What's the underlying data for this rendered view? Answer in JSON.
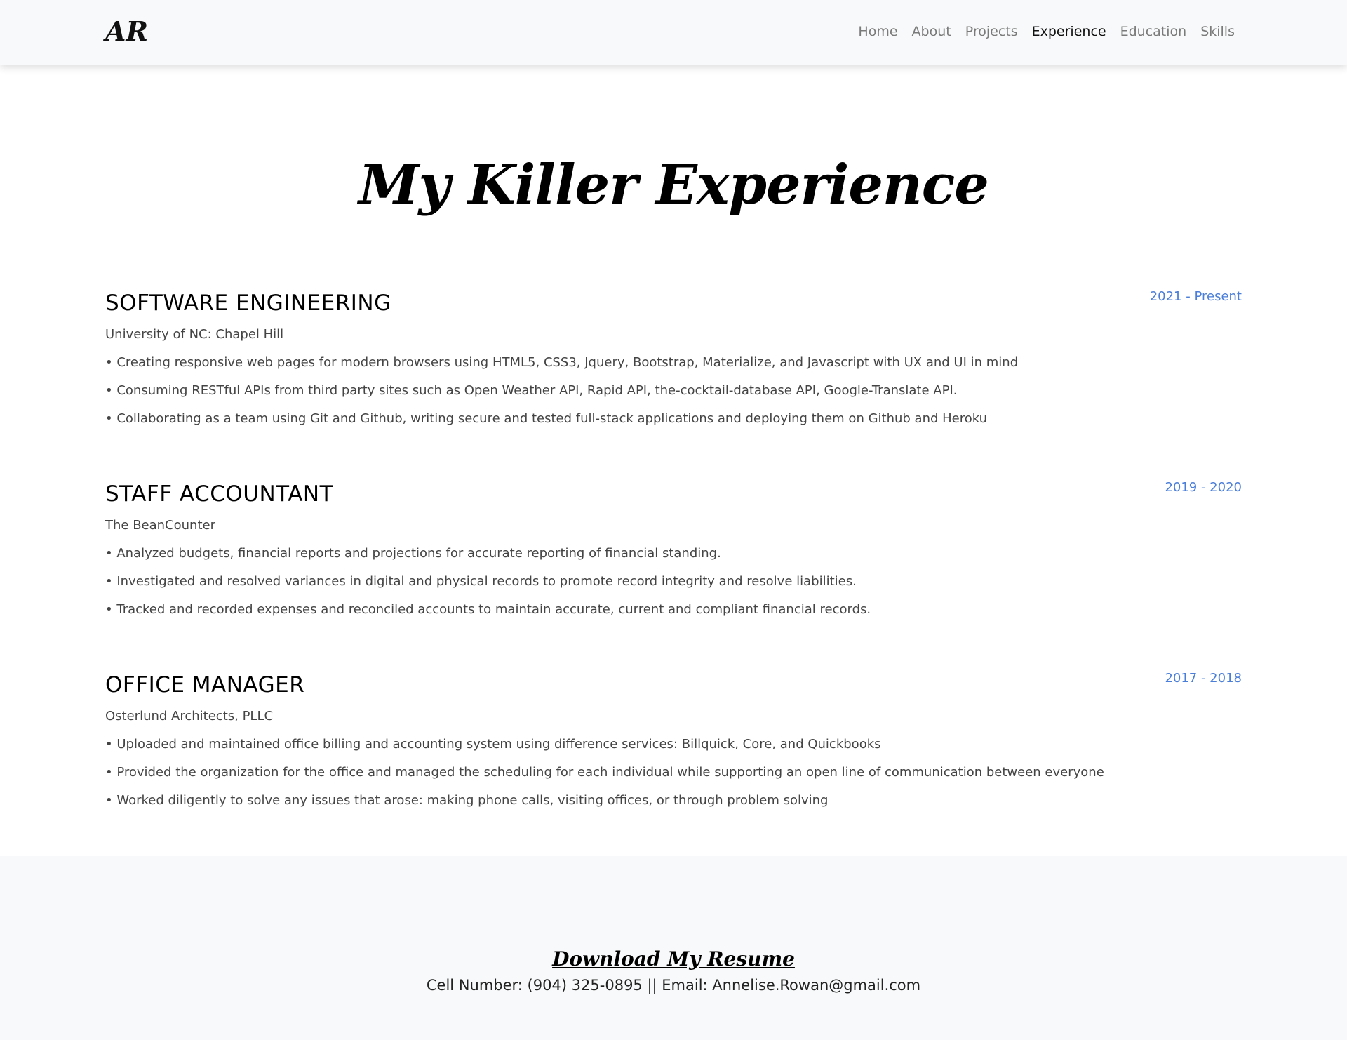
{
  "nav": {
    "brand": "AR",
    "links": [
      "Home",
      "About",
      "Projects",
      "Experience",
      "Education",
      "Skills"
    ],
    "active": "Experience"
  },
  "page_title": "My Killer Experience",
  "experiences": [
    {
      "title": "SOFTWARE ENGINEERING",
      "dates": "2021 - Present",
      "company": "University of NC: Chapel Hill",
      "bullets": [
        "• Creating responsive web pages for modern browsers using HTML5, CSS3, Jquery, Bootstrap, Materialize, and Javascript with UX and UI in mind",
        "• Consuming RESTful APIs from third party sites such as Open Weather API, Rapid API, the-cocktail-database API, Google-Translate API.",
        "• Collaborating as a team using Git and Github, writing secure and tested full-stack applications and deploying them on Github and Heroku"
      ]
    },
    {
      "title": "STAFF ACCOUNTANT",
      "dates": "2019 - 2020",
      "company": "The BeanCounter",
      "bullets": [
        "• Analyzed budgets, financial reports and projections for accurate reporting of financial standing.",
        "• Investigated and resolved variances in digital and physical records to promote record integrity and resolve liabilities.",
        "• Tracked and recorded expenses and reconciled accounts to maintain accurate, current and compliant financial records."
      ]
    },
    {
      "title": "OFFICE MANAGER",
      "dates": "2017 - 2018",
      "company": "Osterlund Architects, PLLC",
      "bullets": [
        "• Uploaded and maintained office billing and accounting system using difference services: Billquick, Core, and Quickbooks",
        "• Provided the organization for the office and managed the scheduling for each individual while supporting an open line of communication between everyone",
        "• Worked diligently to solve any issues that arose: making phone calls, visiting offices, or through problem solving"
      ]
    }
  ],
  "footer": {
    "resume_label": "Download My Resume",
    "contact": "Cell Number: (904) 325-0895 || Email: Annelise.Rowan@gmail.com"
  },
  "colors": {
    "accent": "#4a7ed8",
    "navbar_bg": "#f8f9fa",
    "footer_bg": "#f8f9fa"
  }
}
